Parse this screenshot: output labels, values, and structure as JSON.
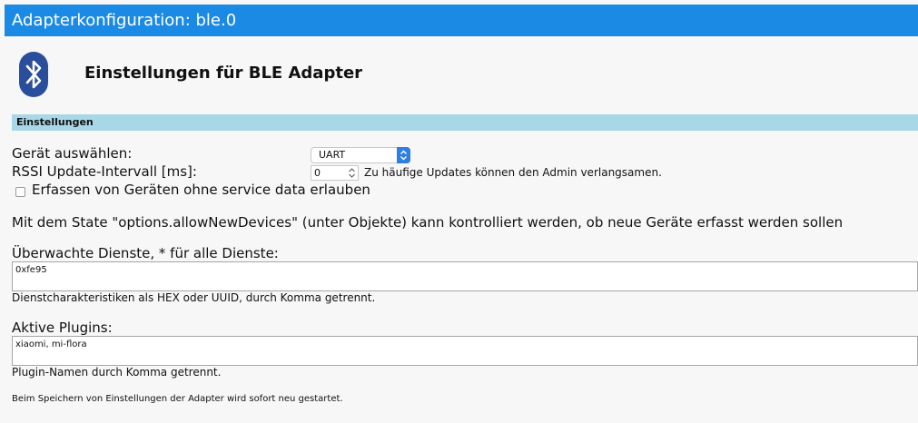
{
  "window": {
    "title": "Adapterkonfiguration: ble.0"
  },
  "header": {
    "logo_icon": "bluetooth-icon",
    "title": "Einstellungen für BLE Adapter"
  },
  "section": {
    "label": "Einstellungen"
  },
  "device": {
    "label": "Gerät auswählen:",
    "selected": "UART"
  },
  "rssi": {
    "label": "RSSI Update-Intervall [ms]:",
    "value": "0",
    "hint": "Zu häufige Updates können den Admin verlangsamen."
  },
  "allow_no_service_data": {
    "label": "Erfassen von Geräten ohne service data erlauben",
    "checked": false
  },
  "info_text": "Mit dem State \"options.allowNewDevices\" (unter Objekte) kann kontrolliert werden, ob neue Geräte erfasst werden sollen",
  "services": {
    "label": "Überwachte Dienste, * für alle Dienste:",
    "value": "0xfe95",
    "hint": "Dienstcharakteristiken als HEX oder UUID, durch Komma getrennt."
  },
  "plugins": {
    "label": "Aktive Plugins:",
    "value": "xiaomi, mi-flora",
    "hint": "Plugin-Namen durch Komma getrennt."
  },
  "footer_note": "Beim Speichern von Einstellungen der Adapter wird sofort neu gestartet.",
  "colors": {
    "titlebar": "#1b8ae4",
    "section_bar": "#a8d8e8",
    "logo_bg": "#2a4d9c"
  }
}
